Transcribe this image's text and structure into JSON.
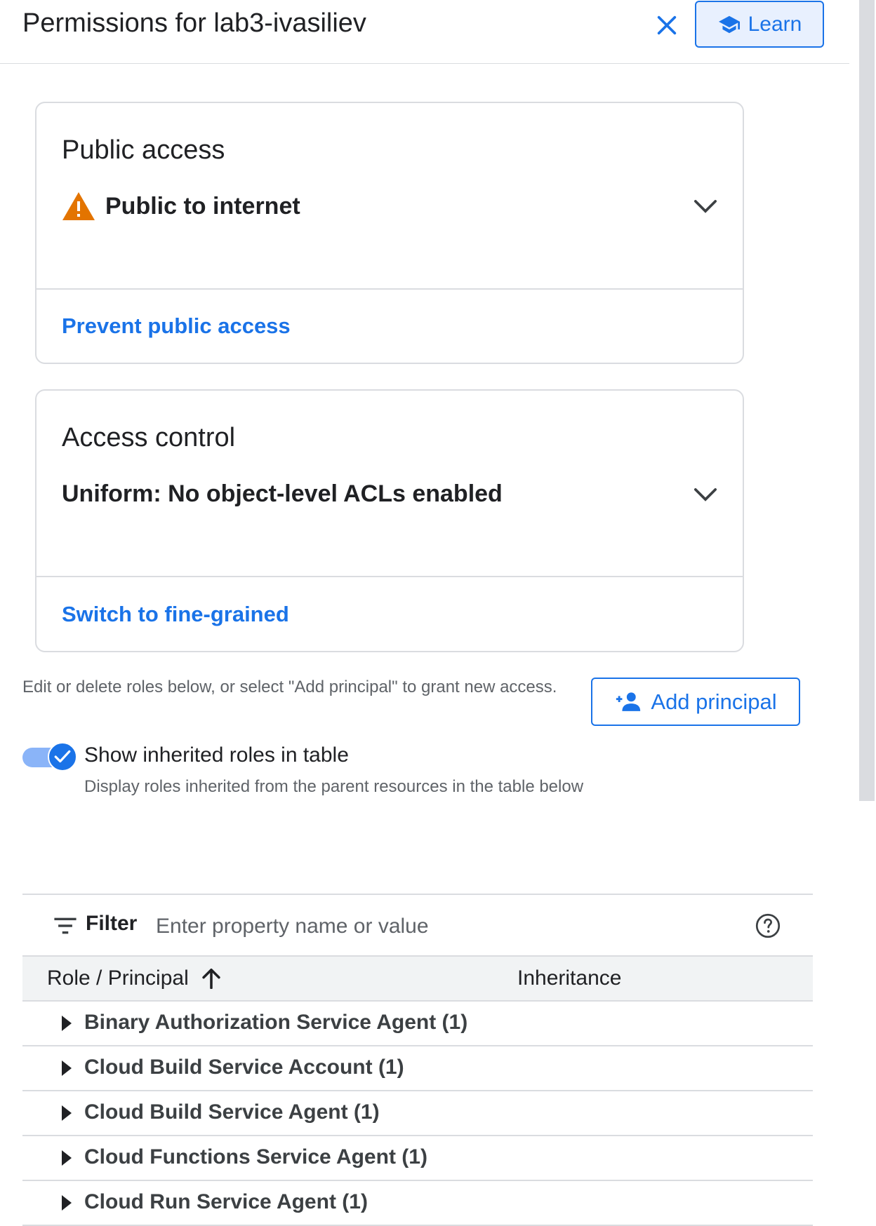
{
  "header": {
    "title": "Permissions for lab3-ivasiliev",
    "close_icon": "close-icon",
    "learn_label": "Learn",
    "learn_icon": "school-icon"
  },
  "public_access": {
    "title": "Public access",
    "status": "Public to internet",
    "status_icon": "warning-icon",
    "action": "Prevent public access"
  },
  "access_control": {
    "title": "Access control",
    "status": "Uniform: No object-level ACLs enabled",
    "action": "Switch to fine-grained"
  },
  "principals": {
    "description": "Edit or delete roles below, or select \"Add principal\" to grant new access.",
    "add_label": "Add principal",
    "add_icon": "person-add-icon"
  },
  "inherited_toggle": {
    "label": "Show inherited roles in table",
    "sublabel": "Display roles inherited from the parent resources in the table below",
    "checked": true
  },
  "filter": {
    "label": "Filter",
    "placeholder": "Enter property name or value"
  },
  "table": {
    "columns": [
      "Role / Principal",
      "Inheritance"
    ],
    "sort": "ascending",
    "rows": [
      "Binary Authorization Service Agent (1)",
      "Cloud Build Service Account (1)",
      "Cloud Build Service Agent (1)",
      "Cloud Functions Service Agent (1)",
      "Cloud Run Service Agent (1)"
    ]
  },
  "colors": {
    "accent": "#1a73e8",
    "warning": "#e37400",
    "border": "#dadce0"
  }
}
